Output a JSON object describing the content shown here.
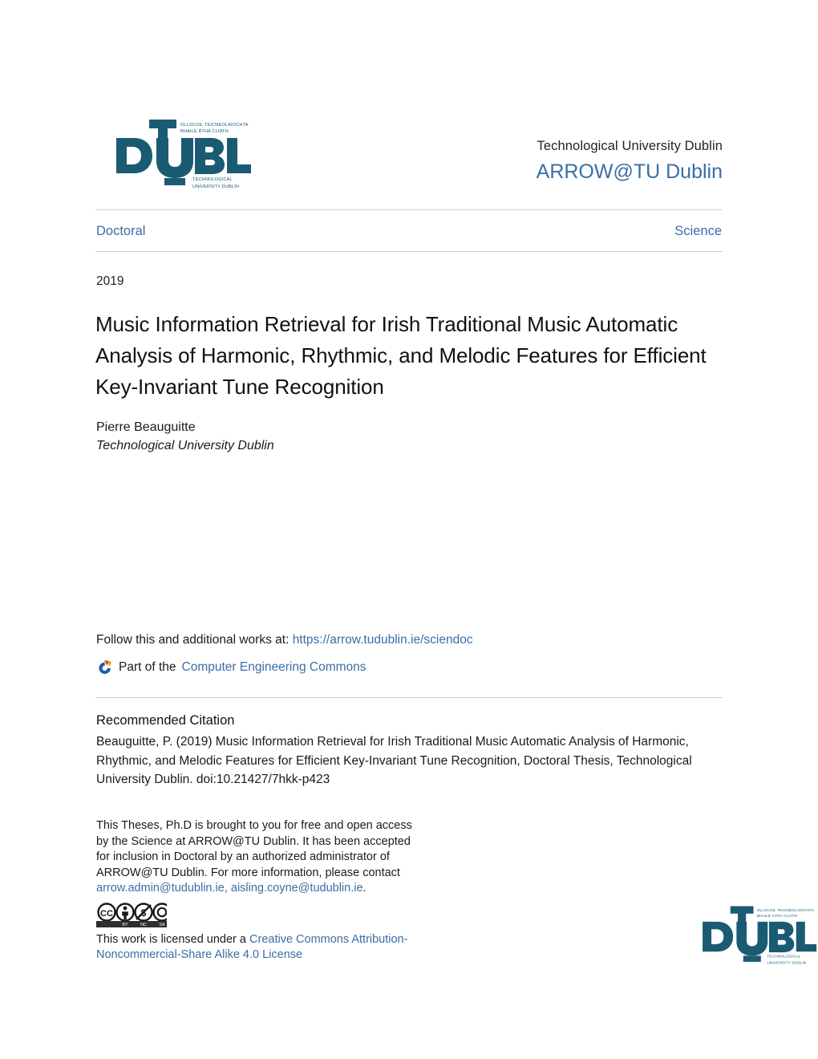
{
  "repository": {
    "institution": "Technological University Dublin",
    "name": "ARROW@TU Dublin"
  },
  "logo": {
    "word_d": "D",
    "word_t": "T",
    "word_u": "U",
    "word_rest": "BLIN",
    "irish_line1": "OLLSCOIL TEICNEOLAÍOCHTA",
    "irish_line2": "BHAILE ÁTHA CLIATH",
    "english_line1": "TECHNOLOGICAL",
    "english_line2": "UNIVERSITY DUBLIN",
    "color": "#1a5b73"
  },
  "nav": {
    "left_label": "Doctoral",
    "right_label": "Science"
  },
  "article": {
    "year": "2019",
    "title": "Music Information Retrieval for Irish Traditional Music Automatic Analysis of Harmonic, Rhythmic, and Melodic Features for Efficient Key-Invariant Tune Recognition",
    "author": "Pierre Beauguitte",
    "affiliation": "Technological University Dublin"
  },
  "follow": {
    "prefix": "Follow this and additional works at:",
    "url": "https://arrow.tudublin.ie/sciendoc",
    "part_of_prefix": "Part of the",
    "commons_link": "Computer Engineering Commons",
    "icon": "bepress-commons-icon"
  },
  "citation": {
    "heading": "Recommended Citation",
    "text": "Beauguitte, P. (2019) Music Information Retrieval for Irish Traditional Music Automatic Analysis of Harmonic, Rhythmic, and Melodic Features for Efficient Key-Invariant Tune Recognition, Doctoral Thesis, Technological University Dublin. doi:10.21427/7hkk-p423"
  },
  "license": {
    "para_part1": "This Theses, Ph.D is brought to you for free and open access by the Science at ARROW@TU Dublin. It has been accepted for inclusion in Doctoral by an authorized administrator of ARROW@TU Dublin. For more information, please contact",
    "email_1": "arrow.admin@tudublin.ie,",
    "email_2": "aisling.coyne@tudublin.ie",
    "para_end": ".",
    "cc_badge_alt": "creative-commons-by-nc-sa-badge",
    "cc_badge_cc": "CC",
    "cc_badge_by": "BY",
    "cc_badge_nc": "NC",
    "cc_badge_sa": "SA",
    "link_prefix": "This work is licensed under a",
    "link_text": "Creative Commons Attribution-Noncommercial-Share Alike 4.0 License"
  },
  "colors": {
    "link": "#3a6ea5",
    "logo": "#1a5b73",
    "rule": "#cfcfcf",
    "text": "#1a1a1a"
  }
}
